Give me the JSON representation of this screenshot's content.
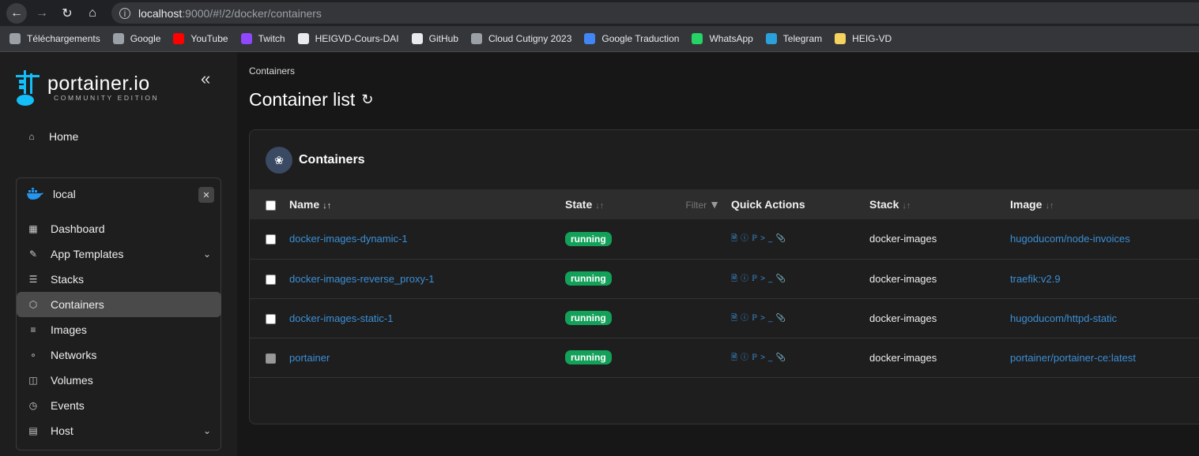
{
  "browser": {
    "url_host": "localhost",
    "url_path": ":9000/#!/2/docker/containers",
    "bookmarks": [
      {
        "label": "Téléchargements",
        "icon": "download-icon",
        "color": "#9aa0a6"
      },
      {
        "label": "Google",
        "icon": "globe-icon",
        "color": "#9aa0a6"
      },
      {
        "label": "YouTube",
        "icon": "youtube-icon",
        "color": "#ff0000"
      },
      {
        "label": "Twitch",
        "icon": "twitch-icon",
        "color": "#9146ff"
      },
      {
        "label": "HEIGVD-Cours-DAI",
        "icon": "github-icon",
        "color": "#e8eaed"
      },
      {
        "label": "GitHub",
        "icon": "github-icon",
        "color": "#e8eaed"
      },
      {
        "label": "Cloud Cutigny 2023",
        "icon": "cloud-icon",
        "color": "#9aa0a6"
      },
      {
        "label": "Google Traduction",
        "icon": "translate-icon",
        "color": "#4285f4"
      },
      {
        "label": "WhatsApp",
        "icon": "whatsapp-icon",
        "color": "#25d366"
      },
      {
        "label": "Telegram",
        "icon": "telegram-icon",
        "color": "#2aa1da"
      },
      {
        "label": "HEIG-VD",
        "icon": "folder-icon",
        "color": "#f4d35e"
      }
    ]
  },
  "sidebar": {
    "logo_main": "portainer.io",
    "logo_sub": "COMMUNITY EDITION",
    "home_label": "Home",
    "env_name": "local",
    "items": [
      {
        "label": "Dashboard",
        "icon": "dashboard-icon",
        "has_chevron": false,
        "active": false
      },
      {
        "label": "App Templates",
        "icon": "edit-icon",
        "has_chevron": true,
        "active": false
      },
      {
        "label": "Stacks",
        "icon": "layers-icon",
        "has_chevron": false,
        "active": false
      },
      {
        "label": "Containers",
        "icon": "box-icon",
        "has_chevron": false,
        "active": true
      },
      {
        "label": "Images",
        "icon": "list-icon",
        "has_chevron": false,
        "active": false
      },
      {
        "label": "Networks",
        "icon": "share-icon",
        "has_chevron": false,
        "active": false
      },
      {
        "label": "Volumes",
        "icon": "database-icon",
        "has_chevron": false,
        "active": false
      },
      {
        "label": "Events",
        "icon": "clock-icon",
        "has_chevron": false,
        "active": false
      },
      {
        "label": "Host",
        "icon": "server-icon",
        "has_chevron": true,
        "active": false
      }
    ]
  },
  "main": {
    "breadcrumb": "Containers",
    "title": "Container list",
    "panel_title": "Containers",
    "columns": {
      "name": "Name",
      "state": "State",
      "filter": "Filter",
      "quick_actions": "Quick Actions",
      "stack": "Stack",
      "image": "Image"
    },
    "rows": [
      {
        "name": "docker-images-dynamic-1",
        "state": "running",
        "stack": "docker-images",
        "image": "hugoducom/node-invoices",
        "checkbox_disabled": false
      },
      {
        "name": "docker-images-reverse_proxy-1",
        "state": "running",
        "stack": "docker-images",
        "image": "traefik:v2.9",
        "checkbox_disabled": false
      },
      {
        "name": "docker-images-static-1",
        "state": "running",
        "stack": "docker-images",
        "image": "hugoducom/httpd-static",
        "checkbox_disabled": false
      },
      {
        "name": "portainer",
        "state": "running",
        "stack": "docker-images",
        "image": "portainer/portainer-ce:latest",
        "checkbox_disabled": true
      }
    ]
  }
}
